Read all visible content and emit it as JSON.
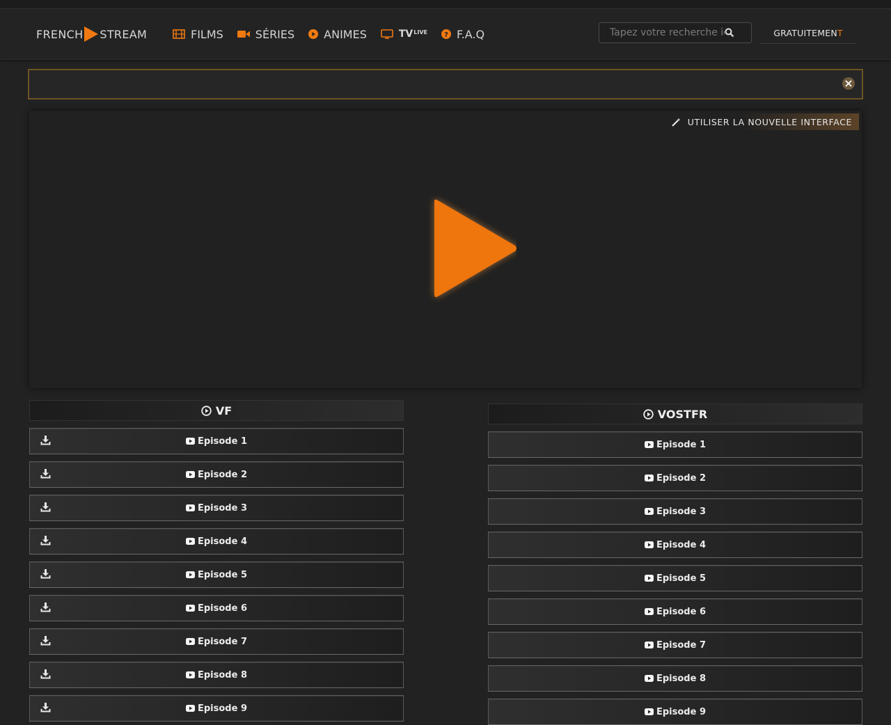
{
  "header": {
    "logo_left": "FRENCH",
    "logo_right": "STREAM",
    "nav": [
      {
        "label": "FILMS",
        "icon": "film-icon"
      },
      {
        "label": "SÉRIES",
        "icon": "video-camera-icon"
      },
      {
        "label": "ANIMES",
        "icon": "play-circle-icon"
      },
      {
        "label": "TV",
        "sup": "LIVE",
        "icon": "tv-icon"
      },
      {
        "label": "F.A.Q",
        "icon": "question-circle-icon"
      }
    ],
    "search_placeholder": "Tapez votre recherche ici",
    "gratuit_main": "GRATUITEMEN",
    "gratuit_last": "T"
  },
  "player": {
    "new_interface_label": "UTILISER LA NOUVELLE INTERFACE"
  },
  "vf": {
    "title": "VF",
    "episodes": [
      "Episode 1",
      "Episode 2",
      "Episode 3",
      "Episode 4",
      "Episode 5",
      "Episode 6",
      "Episode 7",
      "Episode 8",
      "Episode 9"
    ]
  },
  "vostfr": {
    "title": "VOSTFR",
    "episodes": [
      "Episode 1",
      "Episode 2",
      "Episode 3",
      "Episode 4",
      "Episode 5",
      "Episode 6",
      "Episode 7",
      "Episode 8",
      "Episode 9"
    ]
  },
  "colors": {
    "accent": "#f07a11",
    "background": "#222222"
  }
}
